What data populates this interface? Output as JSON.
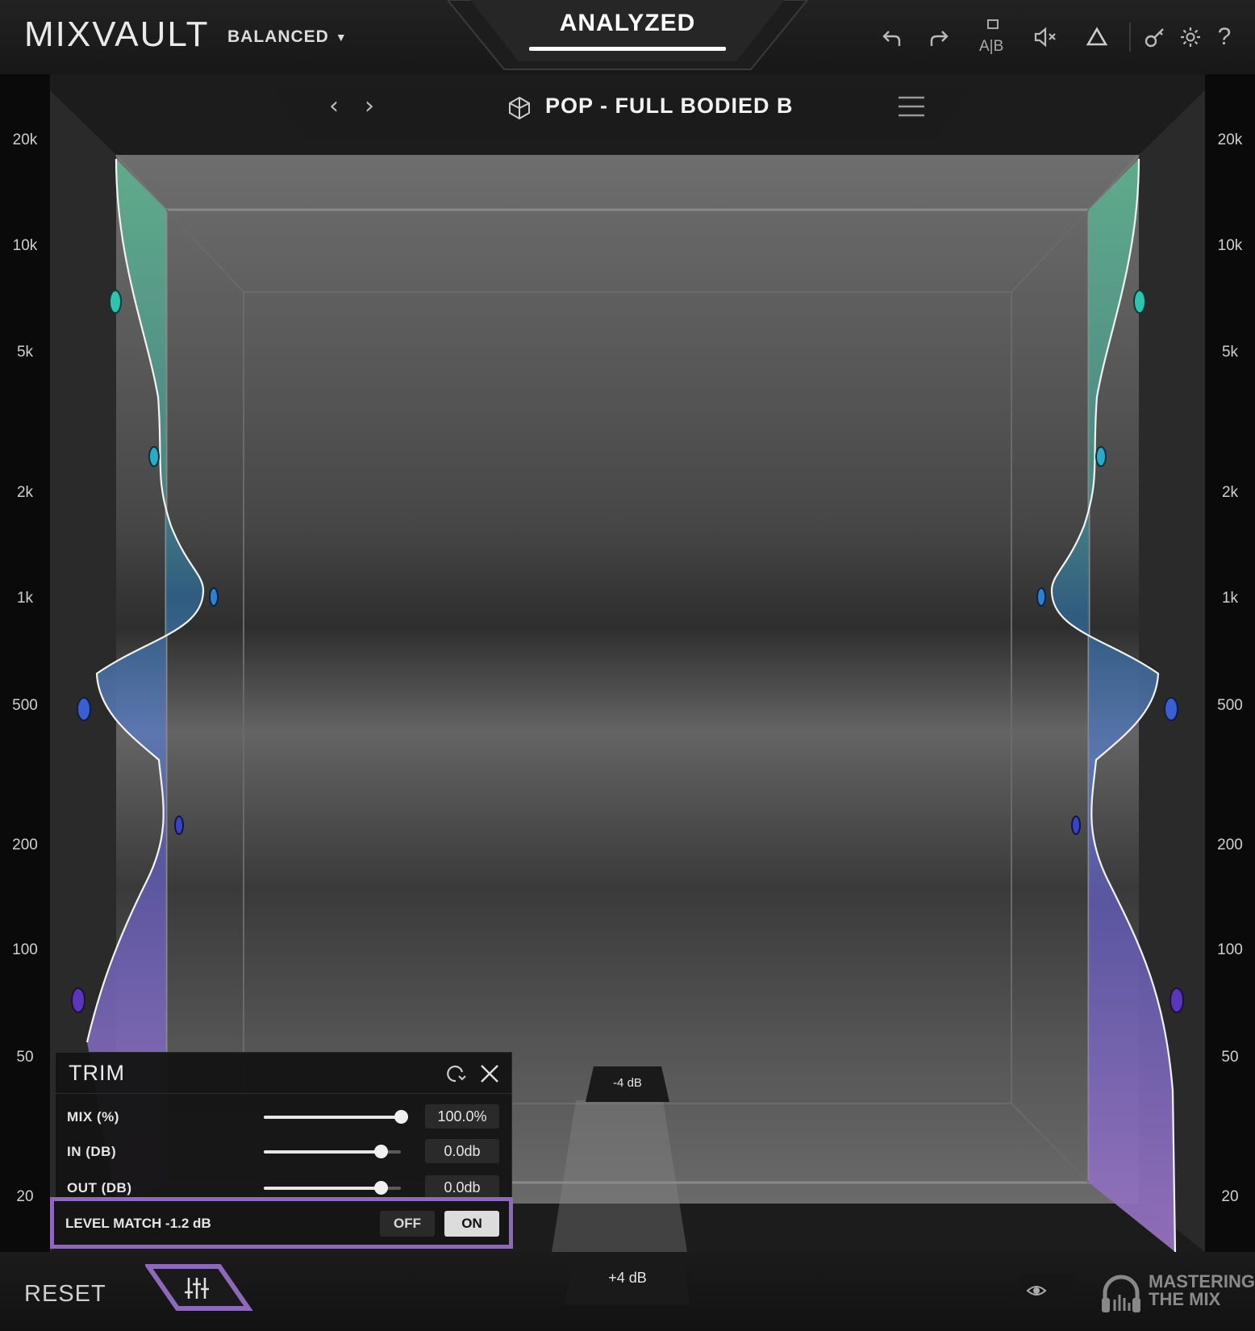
{
  "app": {
    "name": "MIXVAULT",
    "mode": "BALANCED",
    "status_tab": "ANALYZED"
  },
  "header_icons": [
    "undo-icon",
    "redo-icon",
    "ab-compare-icon",
    "mute-icon",
    "triangle-icon",
    "key-icon",
    "gear-icon",
    "help-icon"
  ],
  "preset": {
    "name": "POP - FULL BODIED B"
  },
  "freq_scale": [
    "20k",
    "10k",
    "5k",
    "2k",
    "1k",
    "500",
    "200",
    "100",
    "50",
    "20"
  ],
  "trim": {
    "title": "TRIM",
    "rows": [
      {
        "label": "MIX (%)",
        "value": "100.0%",
        "level": 1.0
      },
      {
        "label": "IN (DB)",
        "value": "0.0db",
        "level": 0.85
      },
      {
        "label": "OUT (DB)",
        "value": "0.0db",
        "level": 0.85
      }
    ],
    "level_match": {
      "label": "LEVEL MATCH -1.2 dB",
      "off": "OFF",
      "on": "ON",
      "state": "ON"
    }
  },
  "db_markers": {
    "top": "-4 dB",
    "bottom": "+4 dB"
  },
  "footer": {
    "reset": "RESET",
    "brand_line1": "MASTERING",
    "brand_line2": "THE MIX"
  },
  "colors": {
    "accent_purple": "#8e69bb",
    "teal": "#5aa58a",
    "blue": "#5b7bc0",
    "violet": "#8a6cc0"
  }
}
